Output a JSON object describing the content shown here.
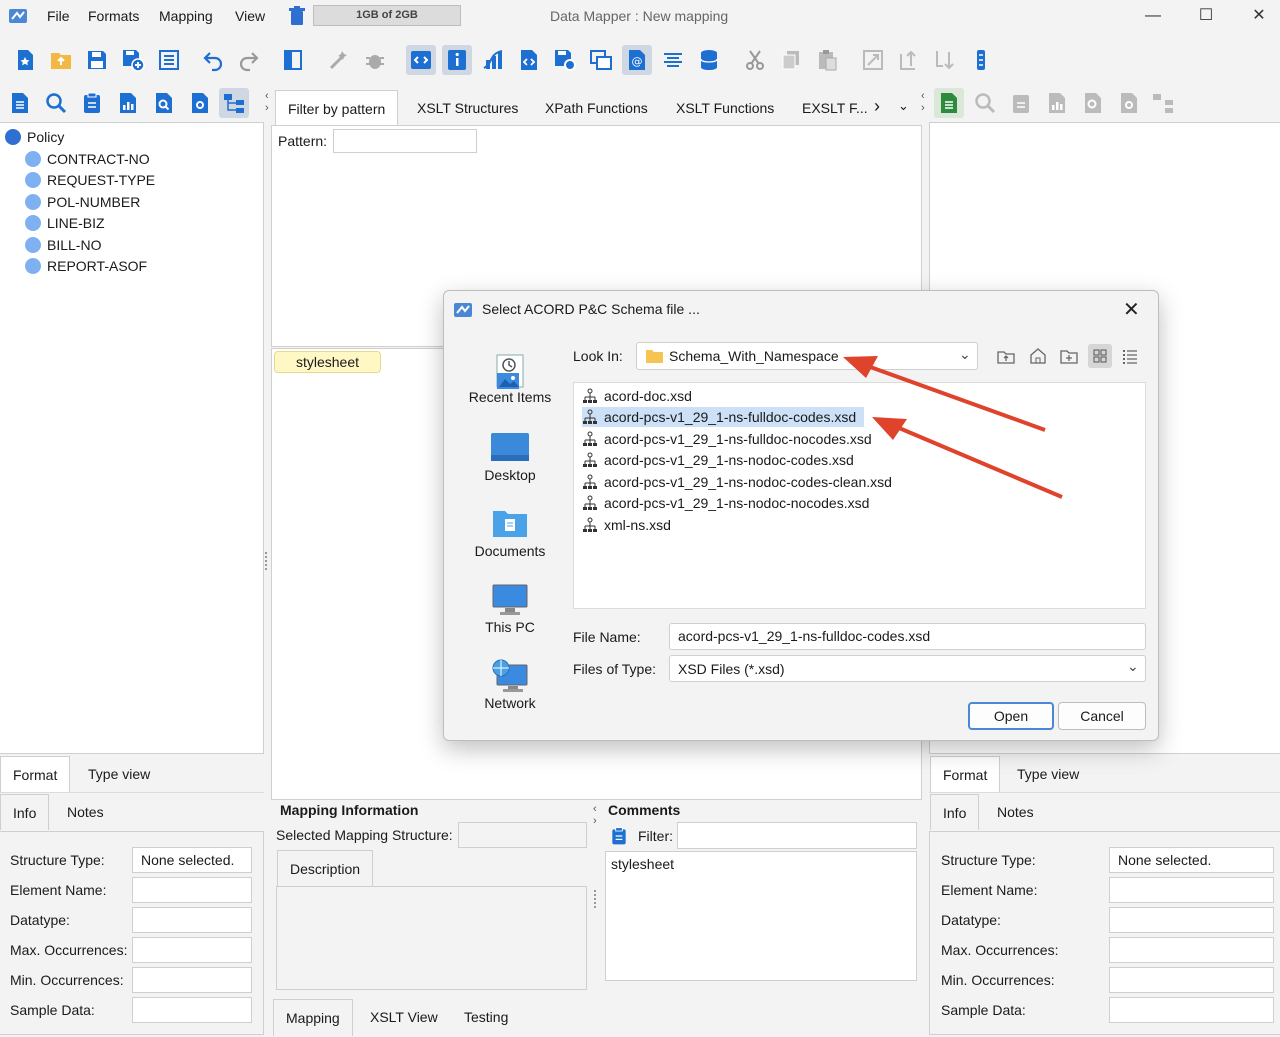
{
  "menu": [
    "File",
    "Formats",
    "Mapping",
    "View"
  ],
  "memory": "1GB of 2GB",
  "window_title": "Data Mapper : New mapping",
  "window_controls": [
    "—",
    "☐",
    "✕"
  ],
  "left_tree": {
    "root": "Policy",
    "children": [
      "CONTRACT-NO",
      "REQUEST-TYPE",
      "POL-NUMBER",
      "LINE-BIZ",
      "BILL-NO",
      "REPORT-ASOF"
    ]
  },
  "center_tabs": [
    "Filter by pattern",
    "XSLT Structures",
    "XPath Functions",
    "XSLT Functions",
    "EXSLT F..."
  ],
  "pattern_label": "Pattern:",
  "stylesheet_chip": "stylesheet",
  "left_bottom": {
    "tabs1": [
      "Format",
      "Type view"
    ],
    "tabs2": [
      "Info",
      "Notes"
    ],
    "props": [
      "Structure Type:",
      "Element Name:",
      "Datatype:",
      "Max. Occurrences:",
      "Min. Occurrences:",
      "Sample Data:"
    ],
    "structure_type_value": "None selected."
  },
  "right_bottom": {
    "tabs1": [
      "Format",
      "Type view"
    ],
    "tabs2": [
      "Info",
      "Notes"
    ],
    "props": [
      "Structure Type:",
      "Element Name:",
      "Datatype:",
      "Max. Occurrences:",
      "Min. Occurrences:",
      "Sample Data:"
    ],
    "structure_type_value": "None selected."
  },
  "mapping_info": {
    "title": "Mapping Information",
    "selected_label": "Selected Mapping Structure:",
    "description_tab": "Description"
  },
  "comments": {
    "title": "Comments",
    "filter_label": "Filter:",
    "items": [
      "stylesheet"
    ]
  },
  "bottom_tabs": [
    "Mapping",
    "XSLT View",
    "Testing"
  ],
  "dialog": {
    "title": "Select ACORD P&C Schema file ...",
    "look_in_label": "Look In:",
    "look_in_value": "Schema_With_Namespace",
    "places": [
      "Recent Items",
      "Desktop",
      "Documents",
      "This PC",
      "Network"
    ],
    "files": [
      "acord-doc.xsd",
      "acord-pcs-v1_29_1-ns-fulldoc-codes.xsd",
      "acord-pcs-v1_29_1-ns-fulldoc-nocodes.xsd",
      "acord-pcs-v1_29_1-ns-nodoc-codes.xsd",
      "acord-pcs-v1_29_1-ns-nodoc-codes-clean.xsd",
      "acord-pcs-v1_29_1-ns-nodoc-nocodes.xsd",
      "xml-ns.xsd"
    ],
    "selected_file_index": 1,
    "file_name_label": "File Name:",
    "file_name_value": "acord-pcs-v1_29_1-ns-fulldoc-codes.xsd",
    "files_of_type_label": "Files of Type:",
    "files_of_type_value": "XSD Files (*.xsd)",
    "open_label": "Open",
    "cancel_label": "Cancel"
  },
  "colors": {
    "accent": "#1d6fd1",
    "selection": "#cce0f7",
    "annotation_arrow": "#e0432b",
    "chip": "#fff7c4"
  }
}
